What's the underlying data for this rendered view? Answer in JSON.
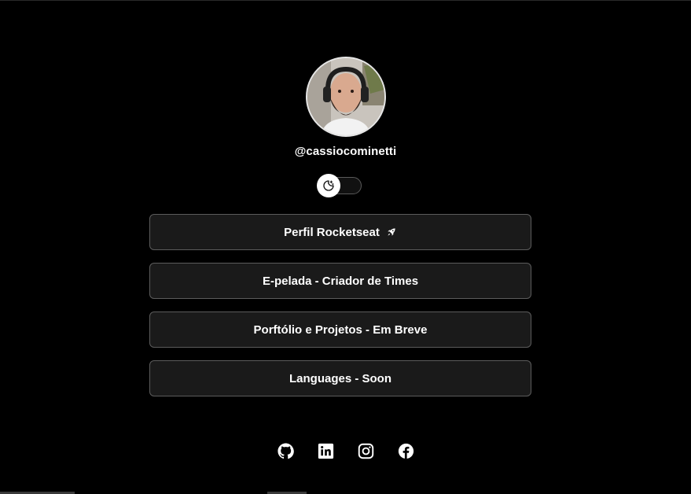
{
  "profile": {
    "username": "@cassiocominetti",
    "avatar_alt": "profile photo"
  },
  "theme_switch": {
    "icon": "moon-stars-icon"
  },
  "links": [
    {
      "label": "Perfil Rocketseat",
      "icon": "rocket-icon"
    },
    {
      "label": "E-pelada - Criador de Times"
    },
    {
      "label": "Porftólio e Projetos - Em Breve"
    },
    {
      "label": "Languages - Soon"
    }
  ],
  "socials": [
    {
      "name": "github-icon"
    },
    {
      "name": "linkedin-icon"
    },
    {
      "name": "instagram-icon"
    },
    {
      "name": "facebook-icon"
    }
  ],
  "colors": {
    "background": "#000000",
    "button_bg": "#1a1a1a",
    "button_border": "#5c5c5c",
    "text": "#ffffff"
  }
}
